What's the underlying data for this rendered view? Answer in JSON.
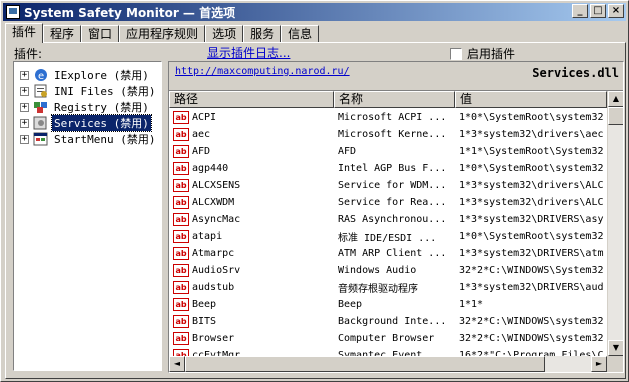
{
  "window": {
    "title": "System Safety Monitor — 首选项",
    "buttons": [
      "_",
      "□",
      "×"
    ]
  },
  "tabs": [
    "插件",
    "程序",
    "窗口",
    "应用程序规则",
    "选项",
    "服务",
    "信息"
  ],
  "plugins_label": "插件:",
  "show_log_link": "显示插件日志...",
  "enable_plugin_label": "启用插件",
  "tree": [
    {
      "label": "IExplore (禁用)",
      "icon": "ie-icon",
      "selected": false
    },
    {
      "label": "INI Files (禁用)",
      "icon": "ini-file-icon",
      "selected": false
    },
    {
      "label": "Registry (禁用)",
      "icon": "registry-icon",
      "selected": false
    },
    {
      "label": "Services (禁用)",
      "icon": "services-icon",
      "selected": true
    },
    {
      "label": "StartMenu (禁用)",
      "icon": "startmenu-icon",
      "selected": false
    }
  ],
  "plugin_url": "http://maxcomputing.narod.ru/",
  "plugin_file": "Services.dll",
  "list": {
    "columns": [
      "路径",
      "名称",
      "值"
    ],
    "rows": [
      [
        "ACPI",
        "Microsoft ACPI ...",
        "1*0*\\SystemRoot\\system32"
      ],
      [
        "aec",
        "Microsoft Kerne...",
        "1*3*system32\\drivers\\aec"
      ],
      [
        "AFD",
        "AFD",
        "1*1*\\SystemRoot\\System32"
      ],
      [
        "agp440",
        "Intel AGP Bus F...",
        "1*0*\\SystemRoot\\system32"
      ],
      [
        "ALCXSENS",
        "Service for WDM...",
        "1*3*system32\\drivers\\ALC"
      ],
      [
        "ALCXWDM",
        "Service for Rea...",
        "1*3*system32\\drivers\\ALC"
      ],
      [
        "AsyncMac",
        "RAS Asynchronou...",
        "1*3*system32\\DRIVERS\\asy"
      ],
      [
        "atapi",
        "标准 IDE/ESDI ...",
        "1*0*\\SystemRoot\\system32"
      ],
      [
        "Atmarpc",
        "ATM ARP Client ...",
        "1*3*system32\\DRIVERS\\atm"
      ],
      [
        "AudioSrv",
        "Windows Audio",
        "32*2*C:\\WINDOWS\\System32"
      ],
      [
        "audstub",
        "音频存根驱动程序",
        "1*3*system32\\DRIVERS\\aud"
      ],
      [
        "Beep",
        "Beep",
        "1*1*"
      ],
      [
        "BITS",
        "Background Inte...",
        "32*2*C:\\WINDOWS\\system32"
      ],
      [
        "Browser",
        "Computer Browser",
        "32*2*C:\\WINDOWS\\system32"
      ],
      [
        "ccEvtMgr",
        "Symantec Event ...",
        "16*2*\"C:\\Program Files\\C"
      ]
    ]
  },
  "scroll": {
    "up": "▲",
    "down": "▼",
    "left": "◄",
    "right": "►"
  }
}
